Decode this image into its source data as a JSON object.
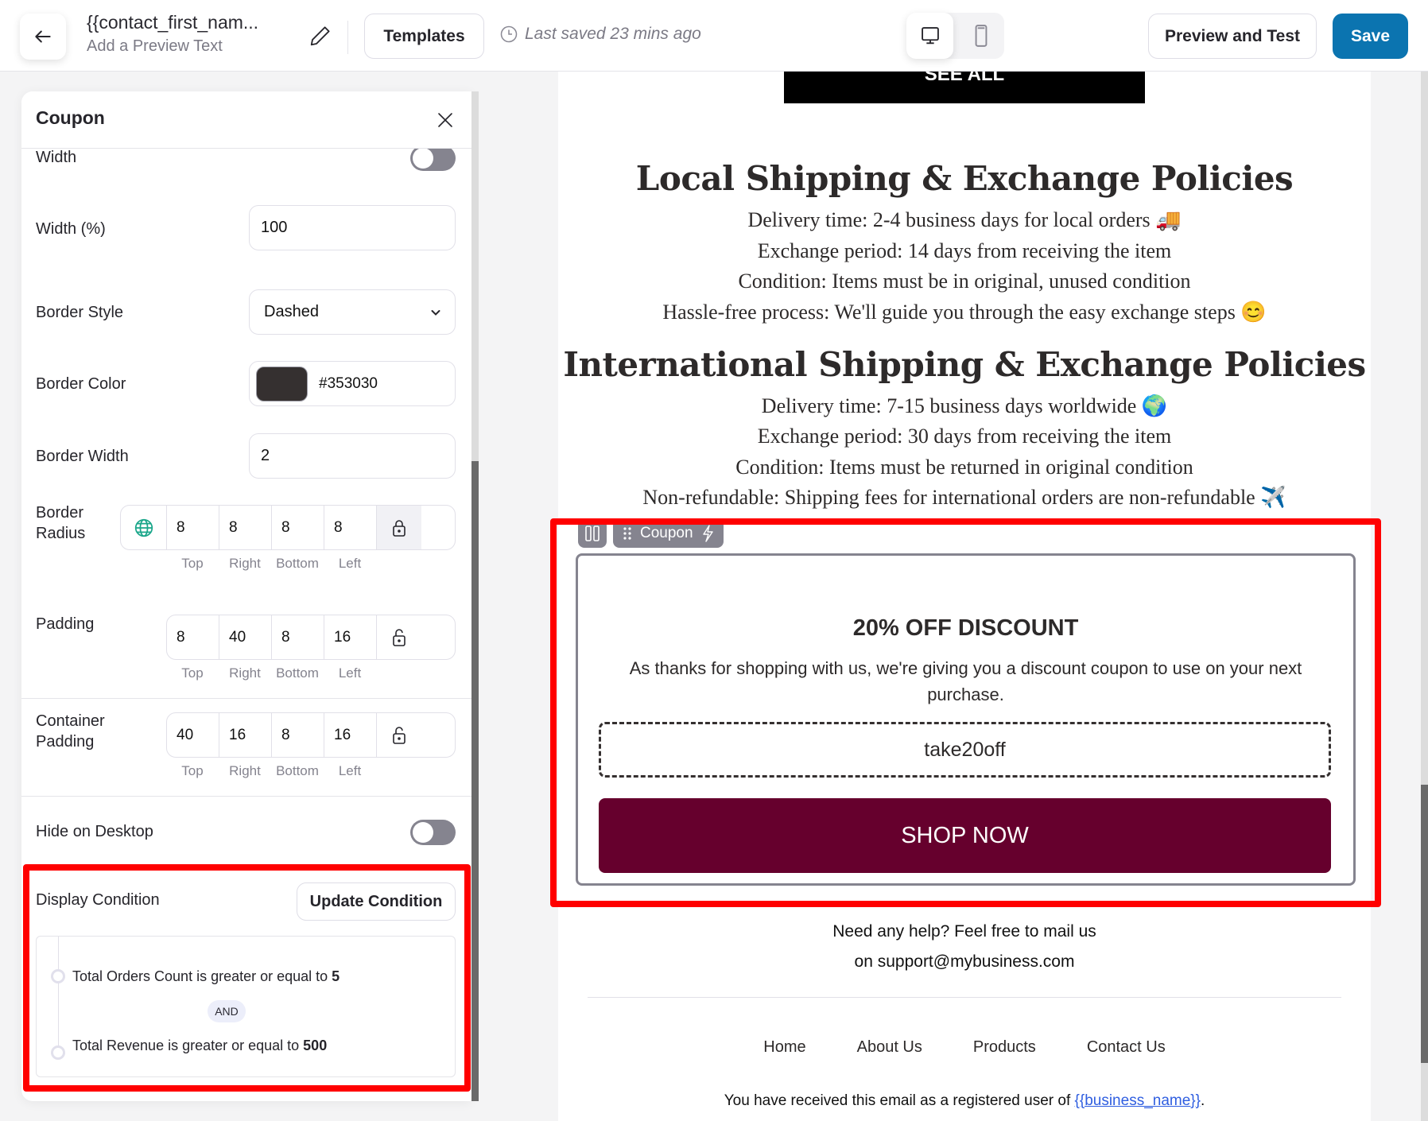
{
  "header": {
    "title": "{{contact_first_nam...",
    "preview_text_placeholder": "Add a Preview Text",
    "templates_label": "Templates",
    "last_saved": "Last saved 23 mins ago",
    "device_active": "desktop",
    "preview_label": "Preview and Test",
    "save_label": "Save",
    "save_color": "#0b74b0"
  },
  "panel": {
    "title": "Coupon",
    "width_toggle_label": "Width",
    "width_toggle_on": false,
    "width_pct_label": "Width (%)",
    "width_pct_value": "100",
    "border_style_label": "Border Style",
    "border_style_value": "Dashed",
    "border_color_label": "Border Color",
    "border_color_value": "#353030",
    "border_width_label": "Border Width",
    "border_width_value": "2",
    "border_radius_label_1": "Border",
    "border_radius_label_2": "Radius",
    "border_radius": {
      "top": "8",
      "right": "8",
      "bottom": "8",
      "left": "8"
    },
    "padding_label": "Padding",
    "padding": {
      "top": "8",
      "right": "40",
      "bottom": "8",
      "left": "16"
    },
    "container_padding_label_1": "Container",
    "container_padding_label_2": "Padding",
    "container_padding": {
      "top": "40",
      "right": "16",
      "bottom": "8",
      "left": "16"
    },
    "side_labels": {
      "top": "Top",
      "right": "Right",
      "bottom": "Bottom",
      "left": "Left"
    },
    "hide_desktop_label": "Hide on Desktop",
    "hide_desktop_on": false,
    "display_condition_label": "Display Condition",
    "update_condition_label": "Update Condition",
    "conditions": [
      {
        "text": "Total Orders Count is greater or equal to ",
        "value": "5"
      },
      {
        "text": "Total Revenue is greater or equal to ",
        "value": "500"
      }
    ],
    "condition_join": "AND"
  },
  "email": {
    "see_all_label": "SEE ALL",
    "local_heading": "Local Shipping & Exchange Policies",
    "local_lines": [
      "Delivery time: 2-4 business days for local orders 🚚",
      "Exchange period: 14 days from receiving the item",
      "Condition: Items must be in original, unused condition",
      "Hassle-free process: We'll guide you through the easy exchange steps 😊"
    ],
    "intl_heading": "International Shipping & Exchange Policies",
    "intl_lines": [
      "Delivery time: 7-15 business days worldwide 🌍",
      "Exchange period: 30 days from receiving the item",
      "Condition: Items must be returned in original condition",
      "Non-refundable: Shipping fees for international orders are non-refundable ✈️"
    ],
    "coupon_tool_label": "Coupon",
    "coupon_title": "20% OFF DISCOUNT",
    "coupon_desc": "As thanks for shopping with us, we're giving you a discount coupon to use on your next purchase.",
    "coupon_code": "take20off",
    "shop_now_label": "SHOP NOW",
    "shop_now_color": "#66002d",
    "help_line_1": "Need any help? Feel free to mail us",
    "help_line_2": "on support@mybusiness.com",
    "footer_links": [
      "Home",
      "About Us",
      "Products",
      "Contact Us"
    ],
    "registered_text": "You have received this email as a registered user of ",
    "registered_link": "{{business_name}}",
    "registered_suffix": "."
  }
}
